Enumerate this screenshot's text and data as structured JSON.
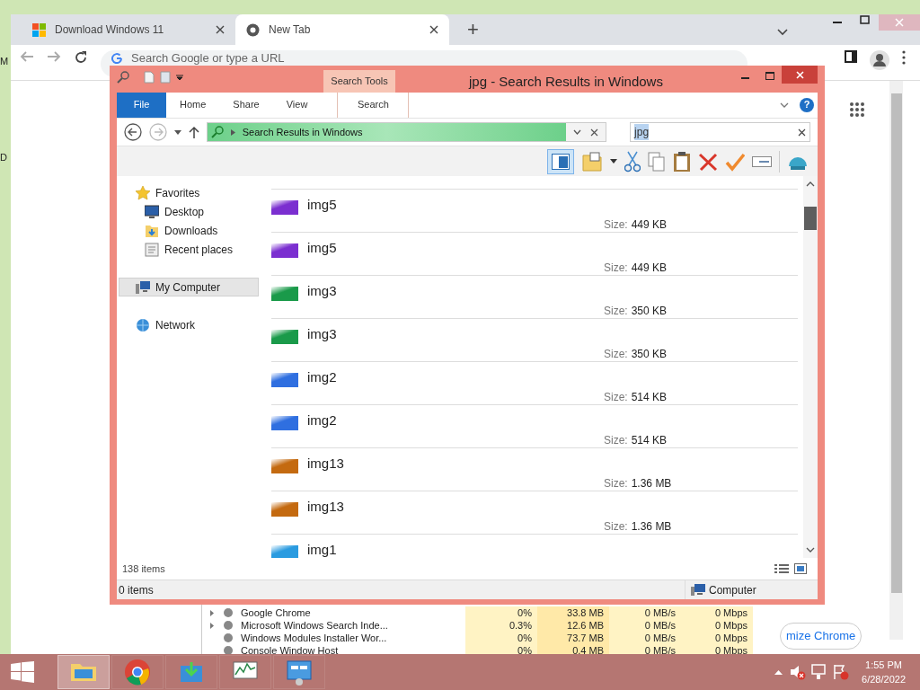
{
  "desktop_fragments": [
    "M",
    "D"
  ],
  "chrome": {
    "tabs": [
      {
        "label": "Download Windows 11",
        "selected": false
      },
      {
        "label": "New Tab",
        "selected": true
      }
    ],
    "new_tab_glyph": "+",
    "address_placeholder": "Search Google or type a URL",
    "customize_button": "mize Chrome",
    "process_rows": [
      {
        "name": "Google Chrome",
        "cpu": "0%",
        "memory": "33.8 MB",
        "disk": "0 MB/s",
        "network": "0 Mbps",
        "expandable": true
      },
      {
        "name": "Microsoft Windows Search Inde...",
        "cpu": "0.3%",
        "memory": "12.6 MB",
        "disk": "0 MB/s",
        "network": "0 Mbps",
        "expandable": true
      },
      {
        "name": "Windows Modules Installer Wor...",
        "cpu": "0%",
        "memory": "73.7 MB",
        "disk": "0 MB/s",
        "network": "0 Mbps",
        "expandable": false
      },
      {
        "name": "Console Window Host",
        "cpu": "0%",
        "memory": "0.4 MB",
        "disk": "0 MB/s",
        "network": "0 Mbps",
        "expandable": false
      }
    ]
  },
  "explorer": {
    "title": "jpg - Search Results in Windows",
    "ribbon_tabs": [
      {
        "label": "File",
        "kind": "file"
      },
      {
        "label": "Home",
        "kind": "tab"
      },
      {
        "label": "Share",
        "kind": "tab"
      },
      {
        "label": "View",
        "kind": "tab"
      },
      {
        "label": "Search",
        "kind": "contextual",
        "group": "Search Tools"
      }
    ],
    "address": {
      "text": "Search Results in Windows",
      "level": 0.9
    },
    "search": {
      "value": "jpg"
    },
    "help_glyph": "?",
    "nav": [
      {
        "label": "Favorites",
        "kind": "section",
        "selected": false
      },
      {
        "label": "Desktop",
        "kind": "item",
        "selected": false
      },
      {
        "label": "Downloads",
        "kind": "item",
        "selected": false
      },
      {
        "label": "Recent places",
        "kind": "item",
        "selected": false
      },
      {
        "label": "My Computer",
        "kind": "section",
        "selected": true
      },
      {
        "label": "Network",
        "kind": "section",
        "selected": false
      }
    ],
    "files": [
      {
        "name": "img5",
        "size_label": "Size:",
        "size": "449 KB",
        "color": "#7b2fd0"
      },
      {
        "name": "img5",
        "size_label": "Size:",
        "size": "449 KB",
        "color": "#7b2fd0"
      },
      {
        "name": "img3",
        "size_label": "Size:",
        "size": "350 KB",
        "color": "#1a9a4a"
      },
      {
        "name": "img3",
        "size_label": "Size:",
        "size": "350 KB",
        "color": "#1a9a4a"
      },
      {
        "name": "img2",
        "size_label": "Size:",
        "size": "514 KB",
        "color": "#2f6fe0"
      },
      {
        "name": "img2",
        "size_label": "Size:",
        "size": "514 KB",
        "color": "#2f6fe0"
      },
      {
        "name": "img13",
        "size_label": "Size:",
        "size": "1.36 MB",
        "color": "#c46a10"
      },
      {
        "name": "img13",
        "size_label": "Size:",
        "size": "1.36 MB",
        "color": "#c46a10"
      },
      {
        "name": "img1",
        "color": "#2a9be0"
      }
    ],
    "item_count": "138 items",
    "selected_count": "0 items",
    "location": "Computer"
  },
  "taskbar": {
    "items": [
      {
        "selected": true
      },
      {
        "selected": false
      },
      {
        "selected": false
      },
      {
        "selected": false
      },
      {
        "selected": false
      }
    ],
    "time": "1:55 PM",
    "date": "6/28/2022"
  }
}
